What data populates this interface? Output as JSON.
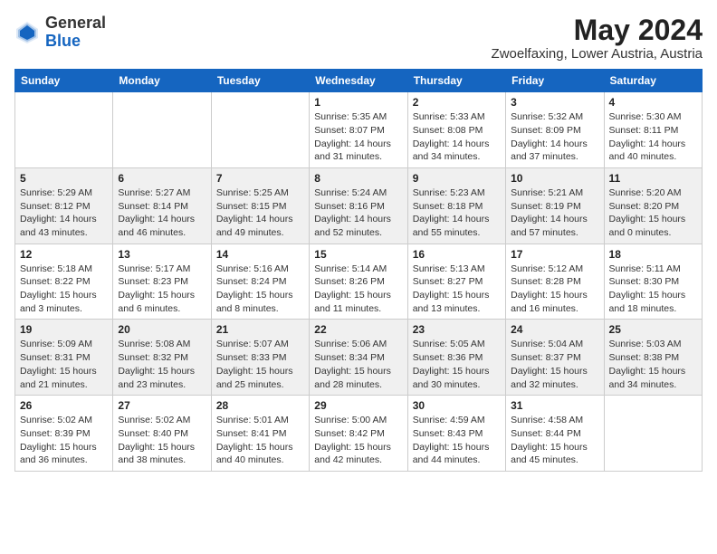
{
  "header": {
    "logo_line1": "General",
    "logo_line2": "Blue",
    "month_year": "May 2024",
    "location": "Zwoelfaxing, Lower Austria, Austria"
  },
  "weekdays": [
    "Sunday",
    "Monday",
    "Tuesday",
    "Wednesday",
    "Thursday",
    "Friday",
    "Saturday"
  ],
  "weeks": [
    [
      {
        "day": "",
        "info": ""
      },
      {
        "day": "",
        "info": ""
      },
      {
        "day": "",
        "info": ""
      },
      {
        "day": "1",
        "info": "Sunrise: 5:35 AM\nSunset: 8:07 PM\nDaylight: 14 hours\nand 31 minutes."
      },
      {
        "day": "2",
        "info": "Sunrise: 5:33 AM\nSunset: 8:08 PM\nDaylight: 14 hours\nand 34 minutes."
      },
      {
        "day": "3",
        "info": "Sunrise: 5:32 AM\nSunset: 8:09 PM\nDaylight: 14 hours\nand 37 minutes."
      },
      {
        "day": "4",
        "info": "Sunrise: 5:30 AM\nSunset: 8:11 PM\nDaylight: 14 hours\nand 40 minutes."
      }
    ],
    [
      {
        "day": "5",
        "info": "Sunrise: 5:29 AM\nSunset: 8:12 PM\nDaylight: 14 hours\nand 43 minutes."
      },
      {
        "day": "6",
        "info": "Sunrise: 5:27 AM\nSunset: 8:14 PM\nDaylight: 14 hours\nand 46 minutes."
      },
      {
        "day": "7",
        "info": "Sunrise: 5:25 AM\nSunset: 8:15 PM\nDaylight: 14 hours\nand 49 minutes."
      },
      {
        "day": "8",
        "info": "Sunrise: 5:24 AM\nSunset: 8:16 PM\nDaylight: 14 hours\nand 52 minutes."
      },
      {
        "day": "9",
        "info": "Sunrise: 5:23 AM\nSunset: 8:18 PM\nDaylight: 14 hours\nand 55 minutes."
      },
      {
        "day": "10",
        "info": "Sunrise: 5:21 AM\nSunset: 8:19 PM\nDaylight: 14 hours\nand 57 minutes."
      },
      {
        "day": "11",
        "info": "Sunrise: 5:20 AM\nSunset: 8:20 PM\nDaylight: 15 hours\nand 0 minutes."
      }
    ],
    [
      {
        "day": "12",
        "info": "Sunrise: 5:18 AM\nSunset: 8:22 PM\nDaylight: 15 hours\nand 3 minutes."
      },
      {
        "day": "13",
        "info": "Sunrise: 5:17 AM\nSunset: 8:23 PM\nDaylight: 15 hours\nand 6 minutes."
      },
      {
        "day": "14",
        "info": "Sunrise: 5:16 AM\nSunset: 8:24 PM\nDaylight: 15 hours\nand 8 minutes."
      },
      {
        "day": "15",
        "info": "Sunrise: 5:14 AM\nSunset: 8:26 PM\nDaylight: 15 hours\nand 11 minutes."
      },
      {
        "day": "16",
        "info": "Sunrise: 5:13 AM\nSunset: 8:27 PM\nDaylight: 15 hours\nand 13 minutes."
      },
      {
        "day": "17",
        "info": "Sunrise: 5:12 AM\nSunset: 8:28 PM\nDaylight: 15 hours\nand 16 minutes."
      },
      {
        "day": "18",
        "info": "Sunrise: 5:11 AM\nSunset: 8:30 PM\nDaylight: 15 hours\nand 18 minutes."
      }
    ],
    [
      {
        "day": "19",
        "info": "Sunrise: 5:09 AM\nSunset: 8:31 PM\nDaylight: 15 hours\nand 21 minutes."
      },
      {
        "day": "20",
        "info": "Sunrise: 5:08 AM\nSunset: 8:32 PM\nDaylight: 15 hours\nand 23 minutes."
      },
      {
        "day": "21",
        "info": "Sunrise: 5:07 AM\nSunset: 8:33 PM\nDaylight: 15 hours\nand 25 minutes."
      },
      {
        "day": "22",
        "info": "Sunrise: 5:06 AM\nSunset: 8:34 PM\nDaylight: 15 hours\nand 28 minutes."
      },
      {
        "day": "23",
        "info": "Sunrise: 5:05 AM\nSunset: 8:36 PM\nDaylight: 15 hours\nand 30 minutes."
      },
      {
        "day": "24",
        "info": "Sunrise: 5:04 AM\nSunset: 8:37 PM\nDaylight: 15 hours\nand 32 minutes."
      },
      {
        "day": "25",
        "info": "Sunrise: 5:03 AM\nSunset: 8:38 PM\nDaylight: 15 hours\nand 34 minutes."
      }
    ],
    [
      {
        "day": "26",
        "info": "Sunrise: 5:02 AM\nSunset: 8:39 PM\nDaylight: 15 hours\nand 36 minutes."
      },
      {
        "day": "27",
        "info": "Sunrise: 5:02 AM\nSunset: 8:40 PM\nDaylight: 15 hours\nand 38 minutes."
      },
      {
        "day": "28",
        "info": "Sunrise: 5:01 AM\nSunset: 8:41 PM\nDaylight: 15 hours\nand 40 minutes."
      },
      {
        "day": "29",
        "info": "Sunrise: 5:00 AM\nSunset: 8:42 PM\nDaylight: 15 hours\nand 42 minutes."
      },
      {
        "day": "30",
        "info": "Sunrise: 4:59 AM\nSunset: 8:43 PM\nDaylight: 15 hours\nand 44 minutes."
      },
      {
        "day": "31",
        "info": "Sunrise: 4:58 AM\nSunset: 8:44 PM\nDaylight: 15 hours\nand 45 minutes."
      },
      {
        "day": "",
        "info": ""
      }
    ]
  ]
}
